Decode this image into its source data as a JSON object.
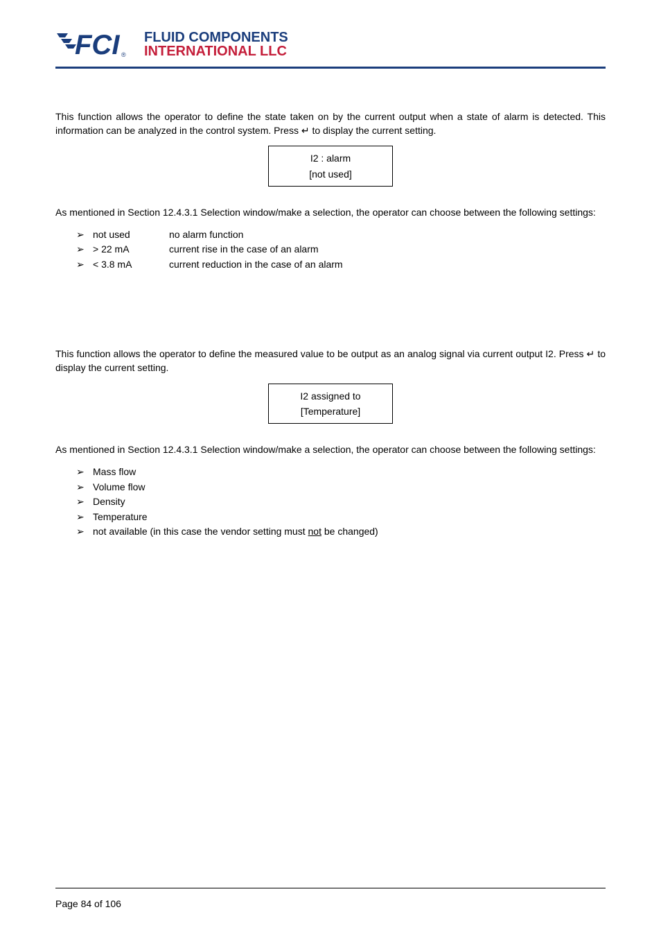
{
  "logo": {
    "line1": "FLUID COMPONENTS",
    "line2": "INTERNATIONAL LLC"
  },
  "section1": {
    "para1": "This function allows the operator to define the state taken on by the current output when a state of alarm is detected. This information can be analyzed in the control system. Press ↵ to display the current setting.",
    "box_line1": "I2 : alarm",
    "box_line2": "[not used]",
    "para2": "As mentioned in Section 12.4.3.1 Selection window/make a selection, the operator can choose between the following settings:",
    "bullets": [
      {
        "col1": "not used",
        "col2": "no alarm function"
      },
      {
        "col1": "> 22 mA",
        "col2": "current rise in the case of an alarm"
      },
      {
        "col1": "< 3.8 mA",
        "col2": "current reduction in the case of an alarm"
      }
    ]
  },
  "section2": {
    "para1": "This function allows the operator to define the measured value to be output as an analog signal via current output I2. Press ↵ to display the current setting.",
    "box_line1": "I2 assigned to",
    "box_line2": "[Temperature]",
    "para2": "As mentioned in Section 12.4.3.1 Selection window/make a selection, the operator can choose between the following settings:",
    "bullets": [
      "Mass flow",
      "Volume flow",
      "Density",
      "Temperature"
    ],
    "bullet_last_pre": "not available (in this case the vendor setting must ",
    "bullet_last_underline": "not",
    "bullet_last_post": " be changed)"
  },
  "footer": {
    "page": "Page 84 of 106"
  }
}
